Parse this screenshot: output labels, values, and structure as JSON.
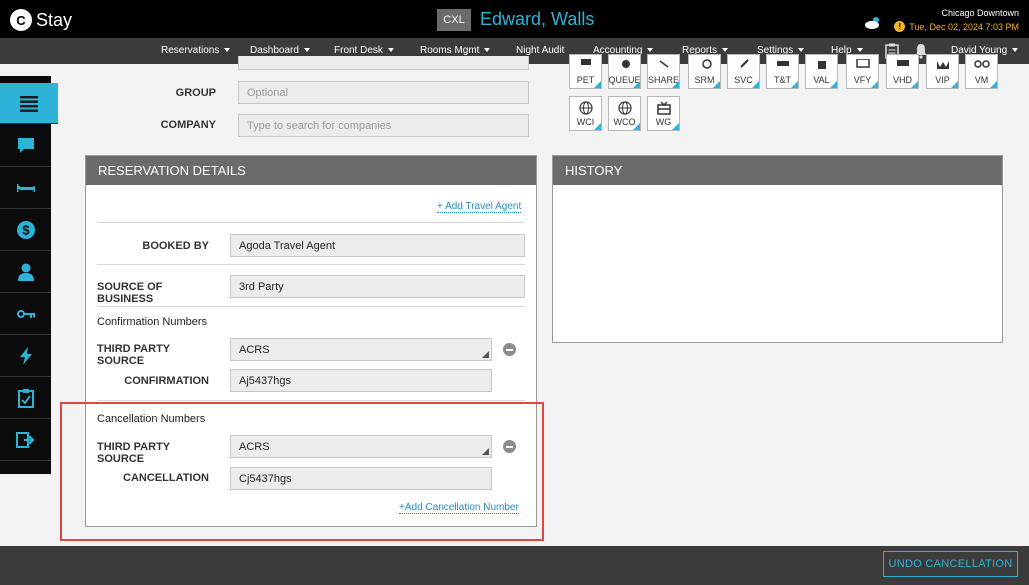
{
  "app": {
    "logo_mark": "C",
    "logo_text": "Stay"
  },
  "header": {
    "status": "CXL",
    "guest_name": "Edward, Walls",
    "location": "Chicago Downtown",
    "datetime": "Tue, Dec 02, 2024 7:03 PM",
    "warning": "!"
  },
  "nav": {
    "items": [
      {
        "label": "Reservations",
        "dropdown": true
      },
      {
        "label": "Dashboard",
        "dropdown": true
      },
      {
        "label": "Front Desk",
        "dropdown": true
      },
      {
        "label": "Rooms Mgmt",
        "dropdown": true
      },
      {
        "label": "Night Audit",
        "dropdown": false
      },
      {
        "label": "Accounting",
        "dropdown": true
      },
      {
        "label": "Reports",
        "dropdown": true
      },
      {
        "label": "Settings",
        "dropdown": true
      },
      {
        "label": "Help",
        "dropdown": true
      }
    ],
    "user": "David Young"
  },
  "sidebar": {
    "items": [
      "list-icon",
      "chat-icon",
      "bed-icon",
      "dollar-icon",
      "person-icon",
      "key-icon",
      "lightning-icon",
      "clipboard-icon",
      "exit-icon"
    ]
  },
  "top_form": {
    "group_label": "GROUP",
    "group_placeholder": "Optional",
    "company_label": "COMPANY",
    "company_placeholder": "Type to search for companies"
  },
  "tags": {
    "row1": [
      "PET",
      "QUEUE",
      "SHARE",
      "SRM",
      "SVC",
      "T&T",
      "VAL",
      "VFY",
      "VHD",
      "VIP",
      "VM"
    ],
    "row2": [
      "WCI",
      "WCO",
      "WG"
    ]
  },
  "reservation_details": {
    "title": "RESERVATION DETAILS",
    "add_travel_agent": "+ Add Travel Agent",
    "booked_by_label": "BOOKED BY",
    "booked_by_value": "Agoda Travel Agent",
    "source_label": "SOURCE OF BUSINESS",
    "source_value": "3rd Party",
    "confirmation_section": "Confirmation Numbers",
    "conf_source_label": "THIRD PARTY SOURCE",
    "conf_source_value": "ACRS",
    "confirmation_label": "CONFIRMATION",
    "confirmation_value": "Aj5437hgs",
    "cancellation_section": "Cancellation Numbers",
    "canc_source_label": "THIRD PARTY SOURCE",
    "canc_source_value": "ACRS",
    "cancellation_label": "CANCELLATION",
    "cancellation_value": "Cj5437hgs",
    "add_cancellation": "+Add Cancellation Number"
  },
  "history": {
    "title": "HISTORY"
  },
  "footer": {
    "undo_label": "UNDO CANCELLATION"
  },
  "colors": {
    "accent": "#2fb2d8",
    "warning": "#f0b429",
    "highlight": "#e0473d"
  }
}
